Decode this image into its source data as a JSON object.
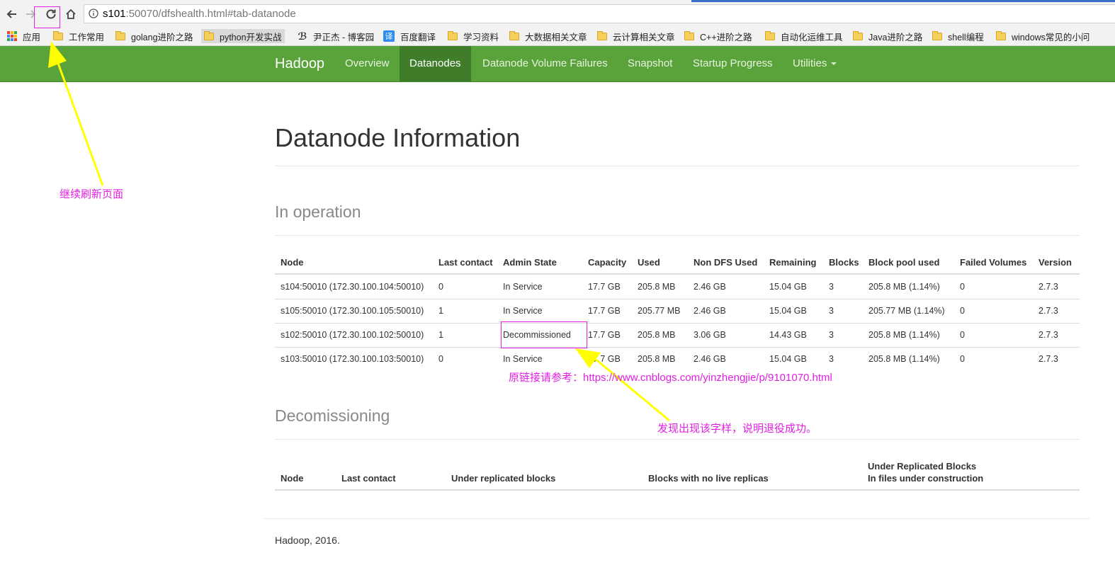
{
  "browser": {
    "url_host": "s101",
    "url_rest": ":50070/dfshealth.html#tab-datanode",
    "bookmarks": [
      {
        "label": "应用",
        "icon": "apps-grid-icon"
      },
      {
        "label": "工作常用",
        "icon": "folder-icon"
      },
      {
        "label": "golang进阶之路",
        "icon": "folder-icon"
      },
      {
        "label": "python开发实战",
        "icon": "folder-icon"
      },
      {
        "label": "尹正杰 - 博客园",
        "icon": "cnblogs-icon"
      },
      {
        "label": "百度翻译",
        "icon": "translate-icon"
      },
      {
        "label": "学习资料",
        "icon": "folder-icon"
      },
      {
        "label": "大数据相关文章",
        "icon": "folder-icon"
      },
      {
        "label": "云计算相关文章",
        "icon": "folder-icon"
      },
      {
        "label": "C++进阶之路",
        "icon": "folder-icon"
      },
      {
        "label": "自动化运维工具",
        "icon": "folder-icon"
      },
      {
        "label": "Java进阶之路",
        "icon": "folder-icon"
      },
      {
        "label": "shell编程",
        "icon": "folder-icon"
      },
      {
        "label": "windows常见的小问",
        "icon": "folder-icon"
      }
    ],
    "translate_glyph": "译"
  },
  "navbar": {
    "brand": "Hadoop",
    "items": [
      "Overview",
      "Datanodes",
      "Datanode Volume Failures",
      "Snapshot",
      "Startup Progress",
      "Utilities"
    ],
    "active": "Datanodes"
  },
  "page": {
    "title": "Datanode Information",
    "in_operation": {
      "heading": "In operation",
      "columns": [
        "Node",
        "Last contact",
        "Admin State",
        "Capacity",
        "Used",
        "Non DFS Used",
        "Remaining",
        "Blocks",
        "Block pool used",
        "Failed Volumes",
        "Version"
      ],
      "rows": [
        [
          "s104:50010 (172.30.100.104:50010)",
          "0",
          "In Service",
          "17.7 GB",
          "205.8 MB",
          "2.46 GB",
          "15.04 GB",
          "3",
          "205.8 MB (1.14%)",
          "0",
          "2.7.3"
        ],
        [
          "s105:50010 (172.30.100.105:50010)",
          "1",
          "In Service",
          "17.7 GB",
          "205.77 MB",
          "2.46 GB",
          "15.04 GB",
          "3",
          "205.77 MB (1.14%)",
          "0",
          "2.7.3"
        ],
        [
          "s102:50010 (172.30.100.102:50010)",
          "1",
          "Decommissioned",
          "17.7 GB",
          "205.8 MB",
          "3.06 GB",
          "14.43 GB",
          "3",
          "205.8 MB (1.14%)",
          "0",
          "2.7.3"
        ],
        [
          "s103:50010 (172.30.100.103:50010)",
          "0",
          "In Service",
          "17.7 GB",
          "205.8 MB",
          "2.46 GB",
          "15.04 GB",
          "3",
          "205.8 MB (1.14%)",
          "0",
          "2.7.3"
        ]
      ]
    },
    "decommissioning": {
      "heading": "Decomissioning",
      "columns": [
        "Node",
        "Last contact",
        "Under replicated blocks",
        "Blocks with no live replicas",
        "Under Replicated Blocks",
        "In files under construction"
      ]
    },
    "footer": "Hadoop, 2016."
  },
  "annotations": {
    "refresh_note": "继续刷新页面",
    "link_prefix": "原链接请参考：",
    "link_url": "https://www.cnblogs.com/yinzhengjie/p/9101070.html",
    "success_note": "发现出现该字样，说明退役成功。",
    "annotation_color": "#e21fe2",
    "arrow_color": "#ffff00"
  }
}
